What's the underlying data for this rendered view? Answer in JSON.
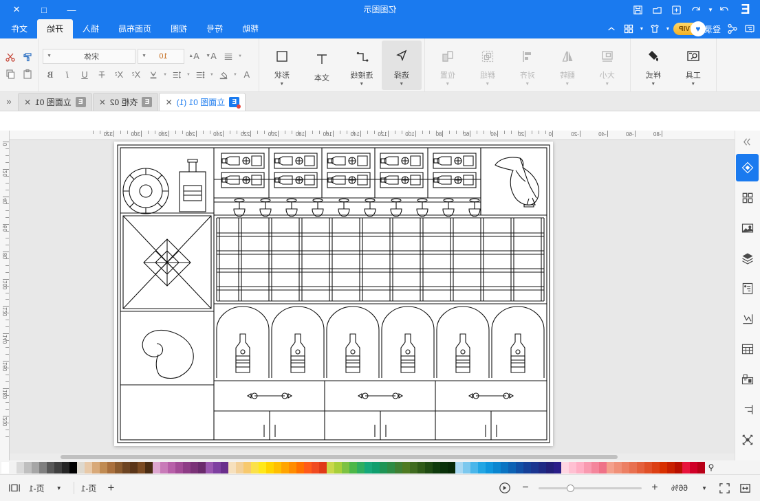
{
  "app": {
    "title": "亿图图示",
    "logo": "E"
  },
  "window_controls": {
    "minimize": "—",
    "maximize": "□",
    "close": "✕"
  },
  "quick_access": {
    "items": [
      {
        "name": "collapse-ribbon",
        "glyph": "⌃"
      },
      {
        "name": "grid-apps",
        "glyph": "grid"
      },
      {
        "name": "theme",
        "glyph": "shirt"
      },
      {
        "name": "login",
        "label": "登录"
      },
      {
        "name": "vip",
        "label": "VIP"
      },
      {
        "name": "share",
        "glyph": "share"
      },
      {
        "name": "feedback",
        "glyph": "comment"
      }
    ]
  },
  "title_icons": [
    {
      "name": "save",
      "glyph": "save"
    },
    {
      "name": "open",
      "glyph": "folder"
    },
    {
      "name": "new",
      "glyph": "plus-box"
    },
    {
      "name": "undo",
      "glyph": "undo"
    },
    {
      "name": "redo",
      "glyph": "redo"
    }
  ],
  "ribbon": {
    "tabs": [
      {
        "label": "文件",
        "active": false
      },
      {
        "label": "开始",
        "active": true
      },
      {
        "label": "插入",
        "active": false
      },
      {
        "label": "页面布局",
        "active": false
      },
      {
        "label": "视图",
        "active": false
      },
      {
        "label": "符号",
        "active": false
      },
      {
        "label": "帮助",
        "active": false
      }
    ],
    "groups": {
      "clipboard": [
        {
          "label": "剪切",
          "icon": "scissors-icon"
        },
        {
          "label": "复制",
          "icon": "copy-icon"
        },
        {
          "label": "粘贴",
          "icon": "paste-icon"
        },
        {
          "label": "格式刷",
          "icon": "format-painter-icon"
        }
      ],
      "font_name": "宋体",
      "font_size": "10",
      "tools": [
        {
          "label": "工具",
          "icon": "tools-icon",
          "dim": false
        },
        {
          "label": "样式",
          "icon": "fill-icon",
          "dim": false
        }
      ],
      "arrange": [
        {
          "label": "大小",
          "icon": "size-icon",
          "dim": true
        },
        {
          "label": "翻转",
          "icon": "flip-icon",
          "dim": true
        },
        {
          "label": "对齐",
          "icon": "align-icon",
          "dim": true
        },
        {
          "label": "群组",
          "icon": "group-icon",
          "dim": true
        },
        {
          "label": "位置",
          "icon": "position-icon",
          "dim": true
        }
      ],
      "insert": [
        {
          "label": "选择",
          "icon": "pointer-icon",
          "selected": true
        },
        {
          "label": "连接线",
          "icon": "connector-icon",
          "selected": false
        },
        {
          "label": "文本",
          "icon": "text-icon",
          "selected": false
        },
        {
          "label": "形状",
          "icon": "shape-icon",
          "selected": false
        }
      ]
    }
  },
  "doc_tabs": [
    {
      "label": "立面图 01",
      "active": false
    },
    {
      "label": "衣柜 02",
      "active": false
    },
    {
      "label": "立面图 01 (1)",
      "active": true
    }
  ],
  "sidebar": {
    "items": [
      {
        "name": "sidebar-expand",
        "icon": "chevron-double-right-icon",
        "active": false
      },
      {
        "name": "sidebar-item-fill",
        "icon": "fill-bucket-icon",
        "active": true
      },
      {
        "name": "sidebar-item-symbols",
        "icon": "grid-squares-icon",
        "active": false
      },
      {
        "name": "sidebar-item-images",
        "icon": "image-icon",
        "active": false
      },
      {
        "name": "sidebar-item-layers",
        "icon": "layers-icon",
        "active": false
      },
      {
        "name": "sidebar-item-pages",
        "icon": "document-icon",
        "active": false
      },
      {
        "name": "sidebar-item-chart",
        "icon": "chart-icon",
        "active": false
      },
      {
        "name": "sidebar-item-table",
        "icon": "table-icon",
        "active": false
      },
      {
        "name": "sidebar-item-diagram",
        "icon": "diagram-icon",
        "active": false
      },
      {
        "name": "sidebar-item-align",
        "icon": "align-left-icon",
        "active": false
      },
      {
        "name": "sidebar-item-connect",
        "icon": "connect-nodes-icon",
        "active": false
      }
    ]
  },
  "canvas": {
    "drawing_name": "wine-cabinet-elevation",
    "h_ruler_labels": [
      "0",
      "20",
      "40",
      "60",
      "80",
      "100",
      "120",
      "140",
      "160",
      "180",
      "200",
      "220",
      "240",
      "260",
      "280",
      "300",
      "320"
    ],
    "v_ruler_labels": [
      "0",
      "20",
      "40",
      "60",
      "80",
      "100",
      "120",
      "140",
      "160",
      "180",
      "200"
    ],
    "h_ruler_negative": [
      "-20",
      "-40",
      "-60",
      "-80"
    ]
  },
  "palette": {
    "colors": [
      "#ffffff",
      "#f2f2f2",
      "#d9d9d9",
      "#bfbfbf",
      "#a6a6a6",
      "#808080",
      "#595959",
      "#404040",
      "#262626",
      "#000000",
      "#ded9cf",
      "#e8c9a8",
      "#d8a979",
      "#c08b52",
      "#a9703d",
      "#8a5a2e",
      "#6d4422",
      "#5a3518",
      "#7a4a22",
      "#4a2c12",
      "#dda6cf",
      "#c87ab8",
      "#b75fa8",
      "#a34b96",
      "#8e3c86",
      "#7a3277",
      "#6a2a6c",
      "#9a56b0",
      "#7e3fa0",
      "#6a2e8c",
      "#f6e0bd",
      "#f3d098",
      "#f7c96d",
      "#fbe14a",
      "#ffe81a",
      "#ffd400",
      "#ffbf00",
      "#ffa400",
      "#ff8c00",
      "#ff7000",
      "#ff5a1a",
      "#f04a20",
      "#e03a18",
      "#c9d84a",
      "#a8cf3a",
      "#7dc242",
      "#4cb748",
      "#2fae60",
      "#16a87a",
      "#0f9e6e",
      "#1e9455",
      "#2e8b45",
      "#3f7f33",
      "#4f7a22",
      "#3f6b20",
      "#2f5a18",
      "#1f4a12",
      "#0f3a0c",
      "#093009",
      "#062806",
      "#a9d8f2",
      "#7cc8ee",
      "#4ab6ea",
      "#22a6e4",
      "#0f96dd",
      "#0a86d0",
      "#0a74c2",
      "#0d62b4",
      "#1150a6",
      "#154098",
      "#1a3590",
      "#1e2a84",
      "#221f78",
      "#2a1e88",
      "#ffd6e2",
      "#ffc0d2",
      "#ffaec4",
      "#f99ab0",
      "#f4869c",
      "#ef7288",
      "#f4a08c",
      "#f09078",
      "#ec8064",
      "#e87050",
      "#e4603c",
      "#e05028",
      "#dc4014",
      "#d83000",
      "#c82000",
      "#b81000",
      "#e8143c",
      "#d00028",
      "#b80018"
    ],
    "picker": {
      "name": "eyedropper-icon",
      "glyph": "⚲"
    }
  },
  "status_bar": {
    "zoom_label": "66%",
    "page_label": "页-1",
    "page_nav_label": "页-1",
    "add_page": "+",
    "zoom_in": "+",
    "zoom_out": "−",
    "fit_width": "fit-width",
    "fit_page": "fit-page",
    "presentation": "presentation-mode",
    "switch_view": "switch-view"
  }
}
